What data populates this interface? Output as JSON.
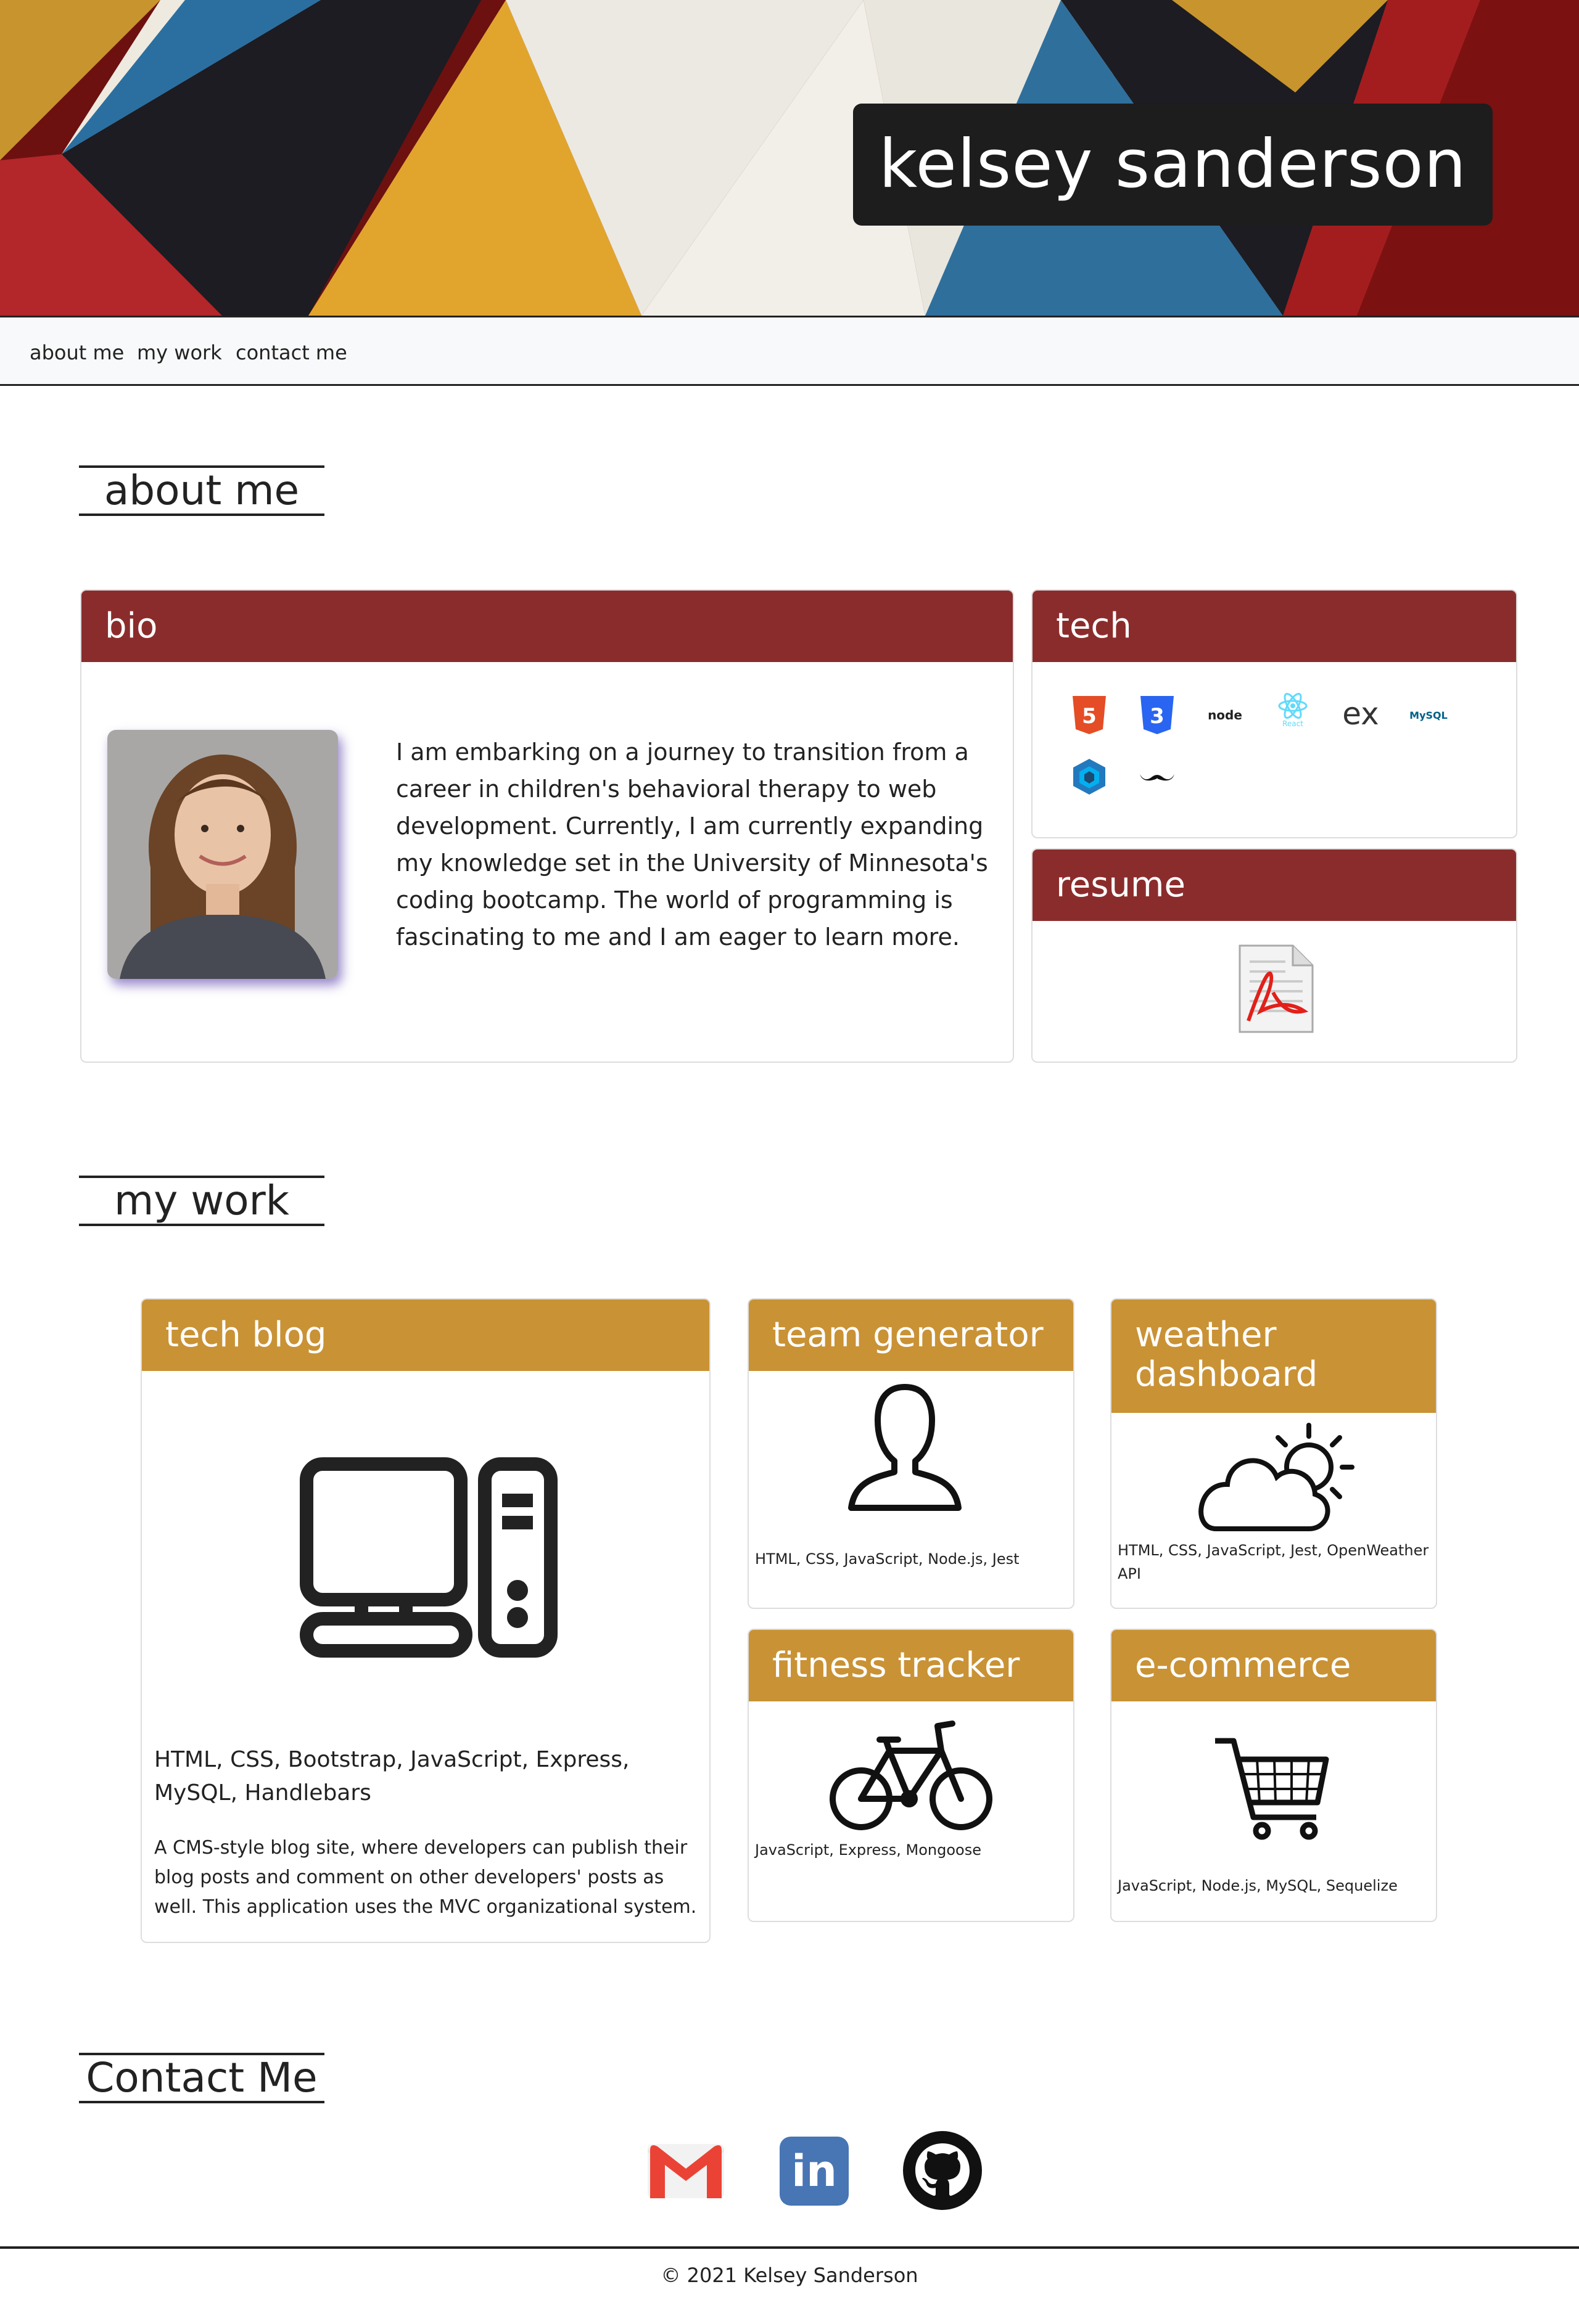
{
  "header": {
    "name": "kelsey sanderson"
  },
  "nav": {
    "items": [
      "about me",
      "my work",
      "contact me"
    ]
  },
  "about": {
    "section_title": "about me",
    "bio": {
      "title": "bio",
      "text": "I am embarking on a journey to transition from a career in children's behavioral therapy to web development. Currently, I am currently expanding my knowledge set in the University of Minnesota's coding bootcamp. The world of programming is fascinating to me and I am eager to learn more."
    },
    "tech": {
      "title": "tech",
      "icons": [
        "html5-icon",
        "css3-icon",
        "node-icon",
        "react-icon",
        "express-icon",
        "mysql-icon",
        "sequelize-icon",
        "handlebars-icon"
      ],
      "node_label": "node",
      "react_label": "React",
      "express_label": "ex",
      "mysql_label": "MySQL"
    },
    "resume": {
      "title": "resume",
      "icon": "pdf-document-icon"
    }
  },
  "work": {
    "section_title": "my work",
    "projects": [
      {
        "title": "tech blog",
        "icon": "desktop-computer-icon",
        "tech": "HTML, CSS, Bootstrap, JavaScript, Express, MySQL, Handlebars",
        "description": "A CMS-style blog site, where developers can publish their blog posts and comment on other developers' posts as well. This application uses the MVC organizational system."
      },
      {
        "title": "team generator",
        "icon": "person-icon",
        "tech": "HTML, CSS, JavaScript, Node.js, Jest"
      },
      {
        "title": "weather dashboard",
        "icon": "cloud-sun-icon",
        "tech": "HTML, CSS, JavaScript, Jest, OpenWeather API"
      },
      {
        "title": "fitness tracker",
        "icon": "bicycle-icon",
        "tech": "JavaScript, Express, Mongoose"
      },
      {
        "title": "e-commerce",
        "icon": "shopping-cart-icon",
        "tech": "JavaScript, Node.js, MySQL, Sequelize"
      }
    ]
  },
  "contact": {
    "section_title": "Contact Me",
    "icons": [
      "gmail-icon",
      "linkedin-icon",
      "github-icon"
    ],
    "linkedin_label": "in"
  },
  "footer": {
    "text": "© 2021 Kelsey Sanderson"
  },
  "colors": {
    "card_header_red": "#8b2c2c",
    "card_header_gold": "#c99235"
  }
}
